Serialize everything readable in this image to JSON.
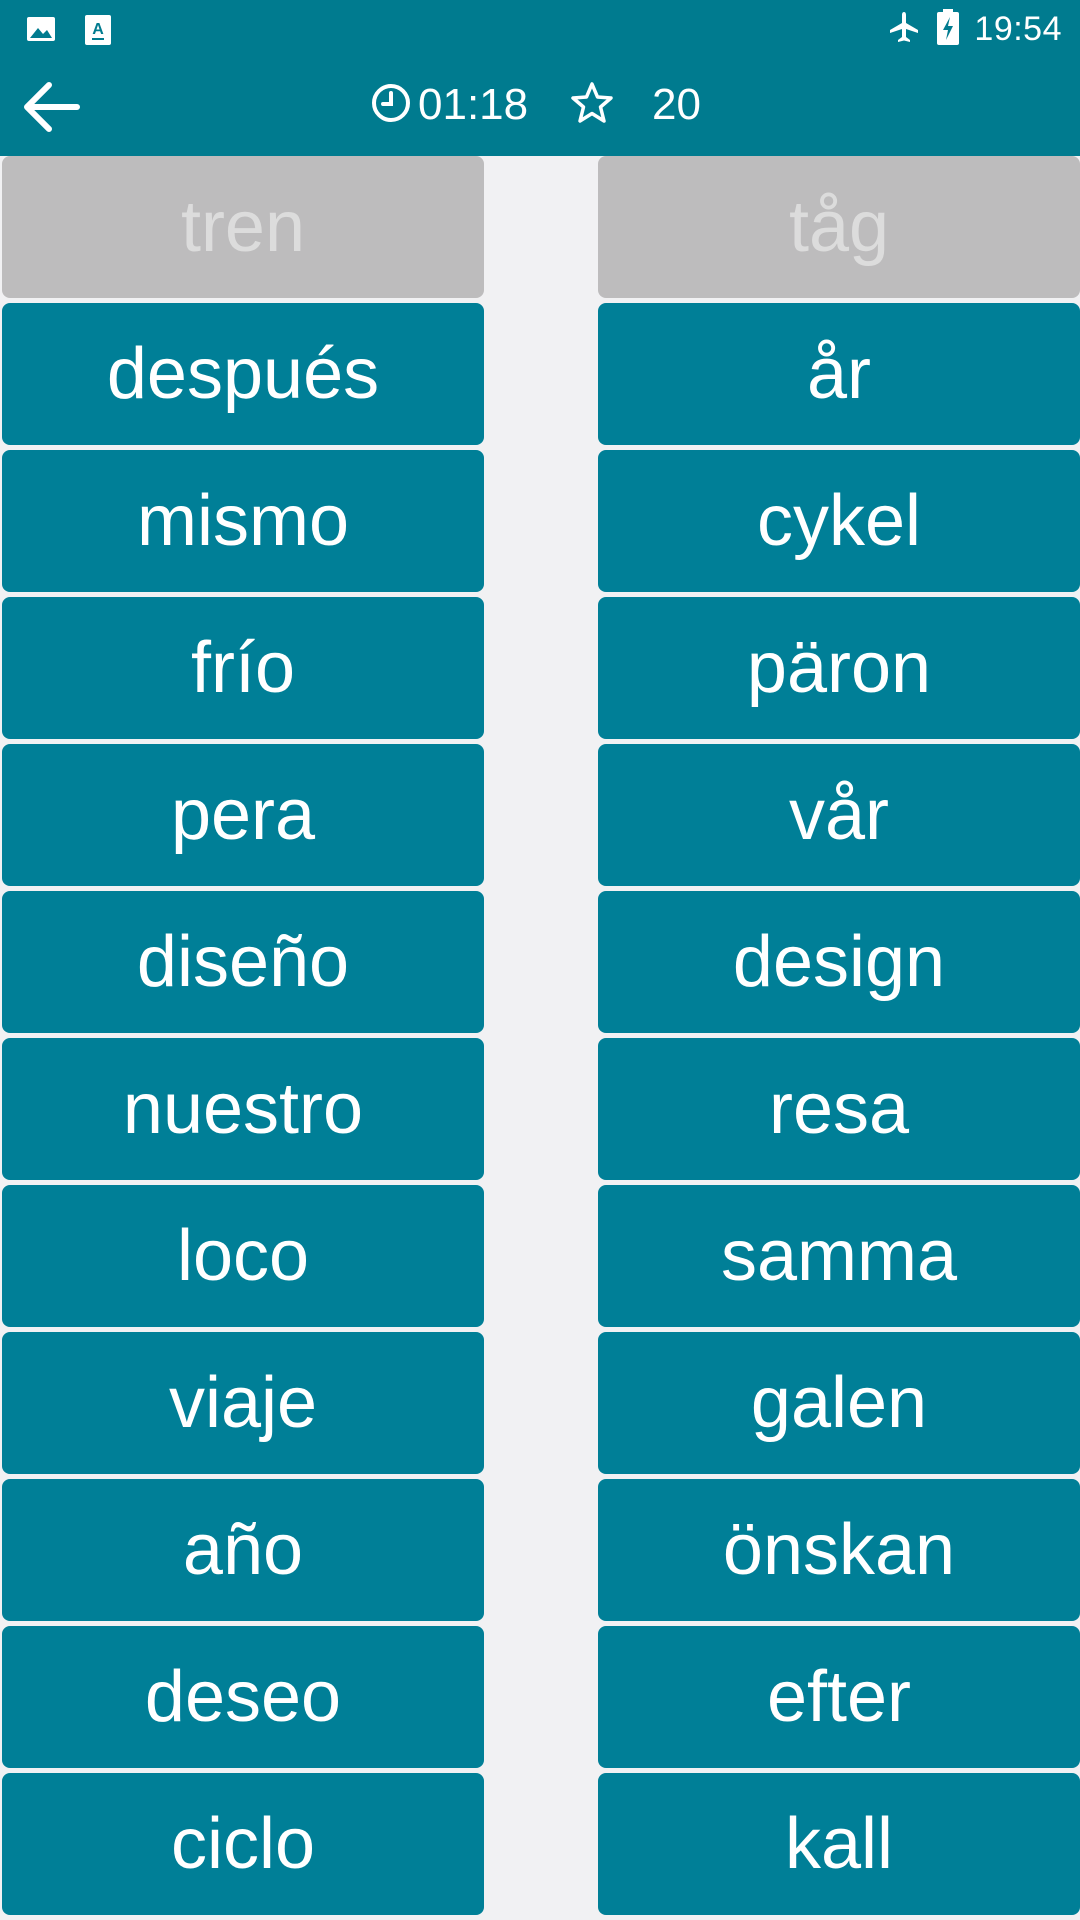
{
  "status_bar": {
    "time": "19:54",
    "left_icons": [
      "image-icon",
      "translate-app-icon"
    ],
    "right_icons": [
      "airplane-mode-icon",
      "battery-charging-icon"
    ]
  },
  "toolbar": {
    "back_icon": "back-arrow-icon",
    "timer": "01:18",
    "timer_icon": "clock-icon",
    "score": "20",
    "score_icon": "star-icon"
  },
  "colors": {
    "header": "#007b8f",
    "tile": "#007f97",
    "tile_matched": "#bdbcbd",
    "background": "#f1f1f3"
  },
  "left_column": [
    {
      "label": "tren",
      "state": "matched"
    },
    {
      "label": "después",
      "state": "active"
    },
    {
      "label": "mismo",
      "state": "active"
    },
    {
      "label": "frío",
      "state": "active"
    },
    {
      "label": "pera",
      "state": "active"
    },
    {
      "label": "diseño",
      "state": "active"
    },
    {
      "label": "nuestro",
      "state": "active"
    },
    {
      "label": "loco",
      "state": "active"
    },
    {
      "label": "viaje",
      "state": "active"
    },
    {
      "label": "año",
      "state": "active"
    },
    {
      "label": "deseo",
      "state": "active"
    },
    {
      "label": "ciclo",
      "state": "active"
    }
  ],
  "right_column": [
    {
      "label": "tåg",
      "state": "matched"
    },
    {
      "label": "år",
      "state": "active"
    },
    {
      "label": "cykel",
      "state": "active"
    },
    {
      "label": "päron",
      "state": "active"
    },
    {
      "label": "vår",
      "state": "active"
    },
    {
      "label": "design",
      "state": "active"
    },
    {
      "label": "resa",
      "state": "active"
    },
    {
      "label": "samma",
      "state": "active"
    },
    {
      "label": "galen",
      "state": "active"
    },
    {
      "label": "önskan",
      "state": "active"
    },
    {
      "label": "efter",
      "state": "active"
    },
    {
      "label": "kall",
      "state": "active"
    }
  ]
}
